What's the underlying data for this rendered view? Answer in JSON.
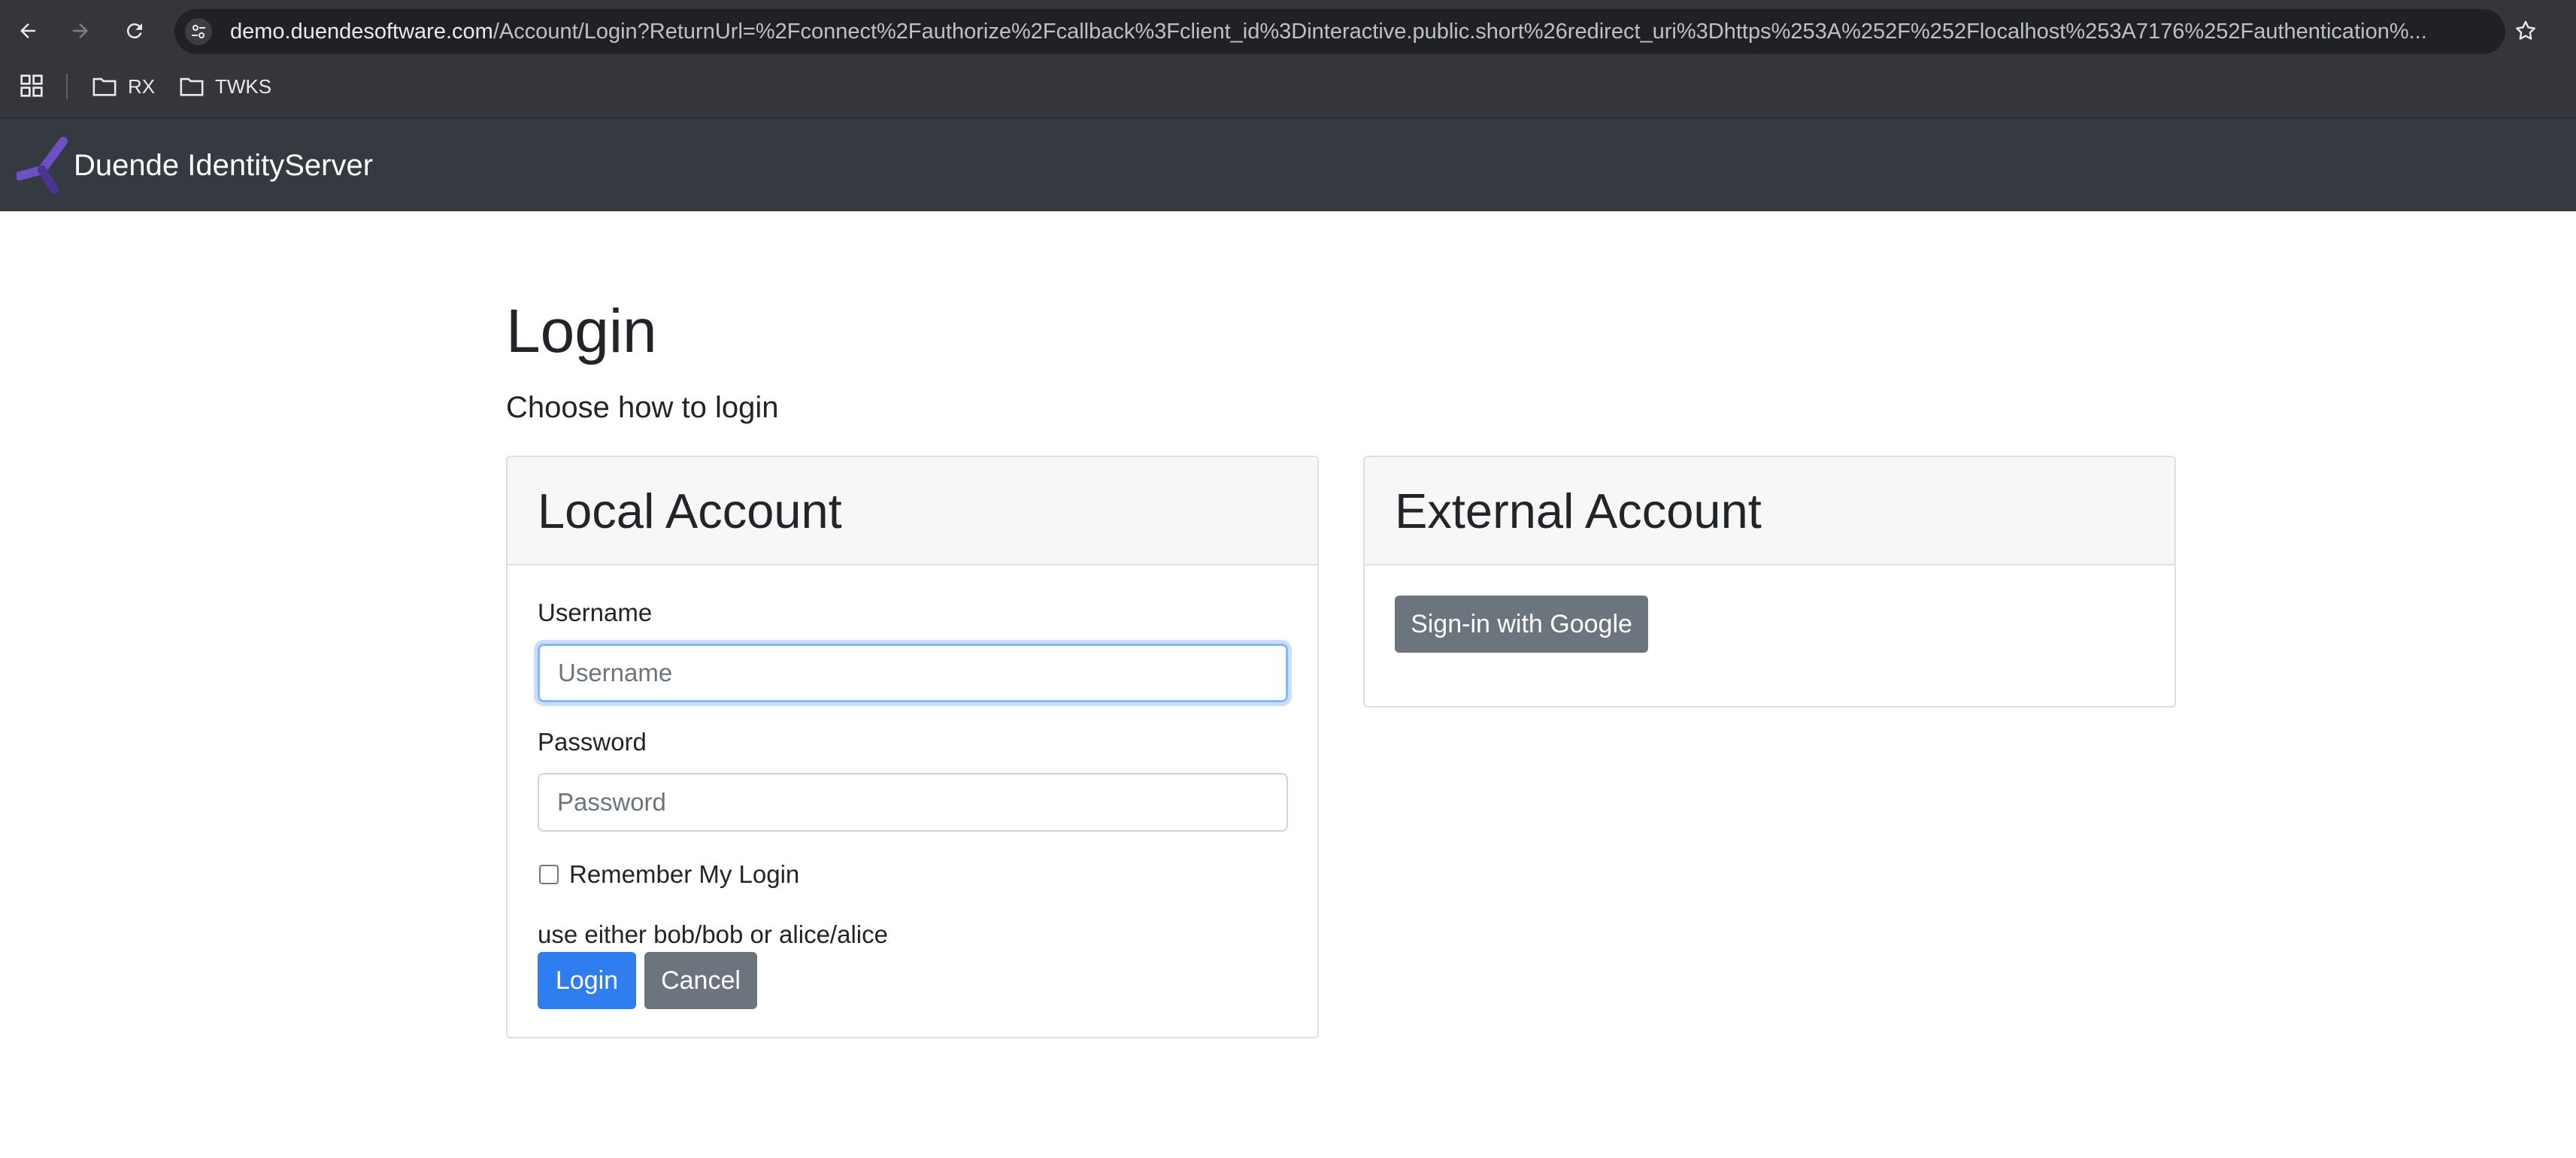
{
  "browser": {
    "url_host": "demo.duendesoftware.com",
    "url_path": "/Account/Login?ReturnUrl=%2Fconnect%2Fauthorize%2Fcallback%3Fclient_id%3Dinteractive.public.short%26redirect_uri%3Dhttps%253A%252F%252Flocalhost%253A7176%252Fauthentication%...",
    "bookmarks": [
      {
        "label": "RX",
        "icon": "folder-icon"
      },
      {
        "label": "TWKS",
        "icon": "folder-icon"
      }
    ]
  },
  "nav": {
    "brand": "Duende IdentityServer",
    "logo_color": "#6f4fc6"
  },
  "page": {
    "title": "Login",
    "subtitle": "Choose how to login"
  },
  "local_account": {
    "header": "Local Account",
    "username_label": "Username",
    "username_placeholder": "Username",
    "password_label": "Password",
    "password_placeholder": "Password",
    "remember_label": "Remember My Login",
    "hint": "use either bob/bob or alice/alice",
    "login_button": "Login",
    "cancel_button": "Cancel"
  },
  "external_account": {
    "header": "External Account",
    "google_button": "Sign-in with Google"
  },
  "colors": {
    "primary": "#2f7ef0",
    "secondary": "#6c757d",
    "navbar": "#343a40"
  }
}
